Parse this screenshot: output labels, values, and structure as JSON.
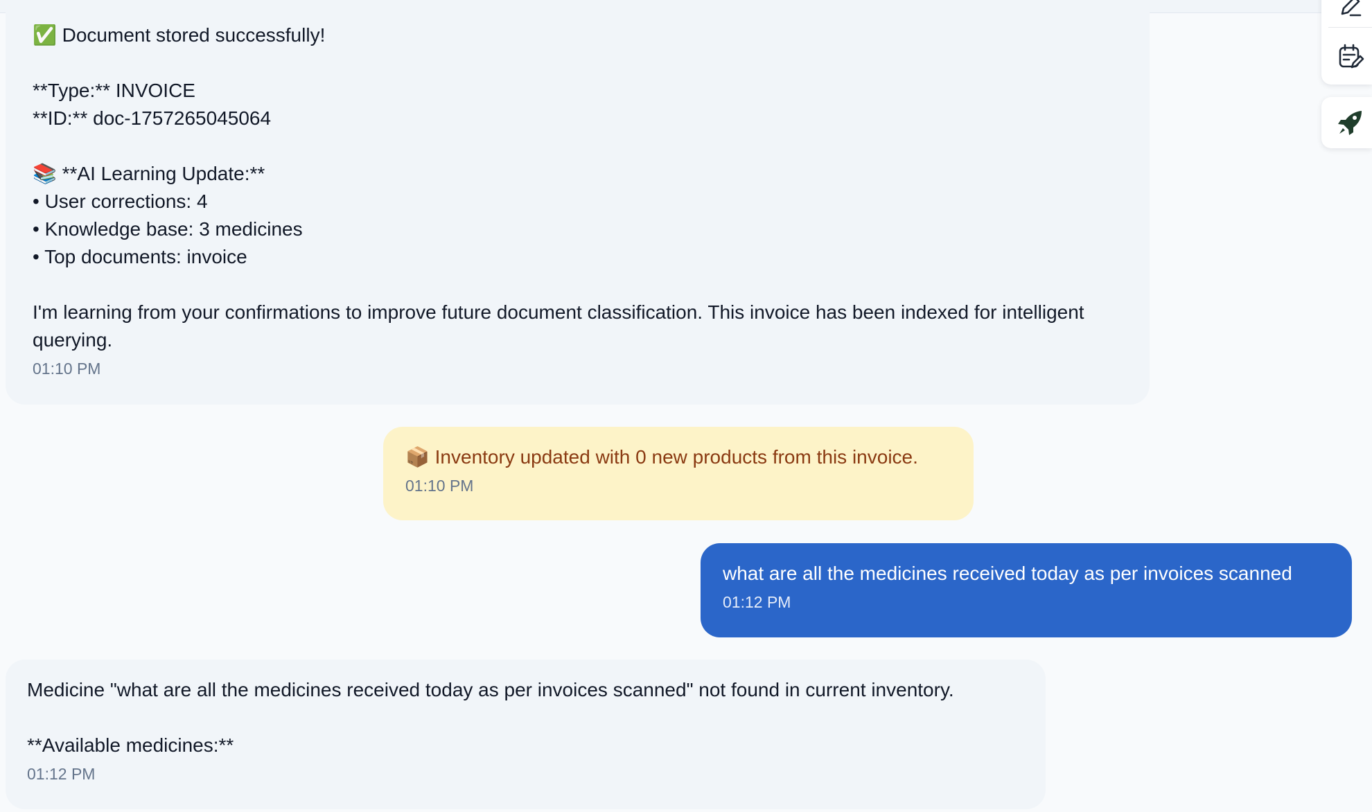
{
  "messages": [
    {
      "role": "assistant",
      "text": "✅ Document stored successfully!\n\n**Type:** INVOICE\n**ID:** doc-1757265045064\n\n📚 **AI Learning Update:**\n• User corrections: 4\n• Knowledge base: 3 medicines\n• Top documents: invoice\n\nI'm learning from your confirmations to improve future document classification. This invoice has been indexed for intelligent querying.",
      "time": "01:10 PM"
    },
    {
      "role": "system",
      "text": "📦 Inventory updated with 0 new products from this invoice.",
      "time": "01:10 PM"
    },
    {
      "role": "user",
      "text": "what are all the medicines received today as per invoices scanned",
      "time": "01:12 PM"
    },
    {
      "role": "assistant",
      "text": "Medicine \"what are all the medicines received today as per invoices scanned\" not found in current inventory.\n\n**Available medicines:**",
      "time": "01:12 PM"
    }
  ],
  "side_toolbar": {
    "icons": [
      "edit-pen-icon",
      "calendar-edit-icon",
      "rocket-icon"
    ]
  },
  "colors": {
    "user_bubble": "#2b66c9",
    "assistant_bubble": "#f1f5f9",
    "system_bubble": "#fdf3c8",
    "system_text": "#8a3a12",
    "timestamp": "#64748b",
    "rocket_icon": "#1f3d2b"
  }
}
